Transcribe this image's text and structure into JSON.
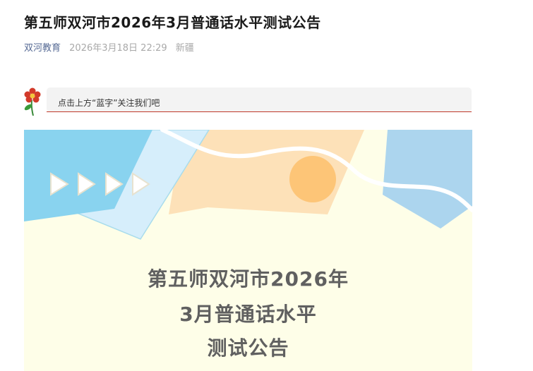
{
  "article": {
    "title": "第五师双河市2026年3月普通话水平测试公告",
    "account": "双河教育",
    "date": "2026年3月18日 22:29",
    "location": "新疆"
  },
  "follow_banner": {
    "text": "点击上方“蓝字”关注我们吧",
    "icon": "flower-icon"
  },
  "cover": {
    "title_lines": [
      "第五师双河市2026年",
      "3月普通话水平",
      "测试公告"
    ],
    "icons": [
      "play-arrow-icon",
      "play-arrow-icon",
      "play-arrow-icon",
      "play-arrow-icon"
    ],
    "colors": {
      "background": "#fefee8",
      "sky_blue": "#89d3ef",
      "pale_blue": "#d6eefb",
      "peach": "#fde1b8",
      "sun": "#fdc577",
      "right_blue": "#acd5ee"
    }
  }
}
